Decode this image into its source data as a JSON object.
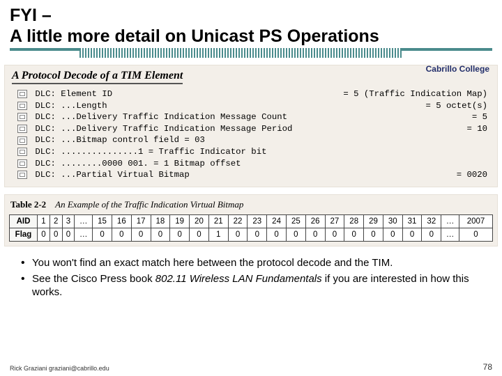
{
  "title_line1": "FYI –",
  "title_line2": "A little more detail on Unicast PS Operations",
  "brand": "Cabrillo College",
  "decode": {
    "heading": "A Protocol Decode of a TIM Element",
    "rows": [
      {
        "left": "DLC: Element ID",
        "right": "= 5 (Traffic Indication Map)"
      },
      {
        "left": "DLC: ...Length",
        "right": "= 5 octet(s)"
      },
      {
        "left": "DLC: ...Delivery Traffic Indication Message Count",
        "right": "= 5"
      },
      {
        "left": "DLC: ...Delivery Traffic Indication Message Period",
        "right": "= 10"
      },
      {
        "left": "DLC: ...Bitmap control field = 03",
        "right": ""
      },
      {
        "left": "DLC: ...............1 = Traffic Indicator bit",
        "right": ""
      },
      {
        "left": "DLC: ........0000 001. = 1 Bitmap offset",
        "right": ""
      },
      {
        "left": "DLC: ...Partial Virtual Bitmap",
        "right": "= 0020"
      }
    ]
  },
  "table": {
    "label": "Table 2-2",
    "caption": "An Example of the Traffic Indication Virtual Bitmap",
    "aid_header": "AID",
    "flag_header": "Flag",
    "aid": [
      "1",
      "2",
      "3",
      "…",
      "15",
      "16",
      "17",
      "18",
      "19",
      "20",
      "21",
      "22",
      "23",
      "24",
      "25",
      "26",
      "27",
      "28",
      "29",
      "30",
      "31",
      "32",
      "…",
      "2007"
    ],
    "flag": [
      "0",
      "0",
      "0",
      "…",
      "0",
      "0",
      "0",
      "0",
      "0",
      "0",
      "1",
      "0",
      "0",
      "0",
      "0",
      "0",
      "0",
      "0",
      "0",
      "0",
      "0",
      "0",
      "…",
      "0"
    ]
  },
  "bullets": {
    "b1a": "You won't find an exact match here between the protocol decode and the TIM.",
    "b2a": "See the Cisco Press book ",
    "b2em": "802.11 Wireless LAN Fundamentals",
    "b2b": " if you are interested in how this works."
  },
  "footer_author": "Rick Graziani  graziani@cabrillo.edu",
  "page_number": "78",
  "chart_data": {
    "type": "table",
    "title": "Traffic Indication Virtual Bitmap",
    "columns": [
      "1",
      "2",
      "3",
      "…",
      "15",
      "16",
      "17",
      "18",
      "19",
      "20",
      "21",
      "22",
      "23",
      "24",
      "25",
      "26",
      "27",
      "28",
      "29",
      "30",
      "31",
      "32",
      "…",
      "2007"
    ],
    "rows": [
      {
        "name": "Flag",
        "values": [
          "0",
          "0",
          "0",
          "…",
          "0",
          "0",
          "0",
          "0",
          "0",
          "0",
          "1",
          "0",
          "0",
          "0",
          "0",
          "0",
          "0",
          "0",
          "0",
          "0",
          "0",
          "0",
          "…",
          "0"
        ]
      }
    ]
  }
}
